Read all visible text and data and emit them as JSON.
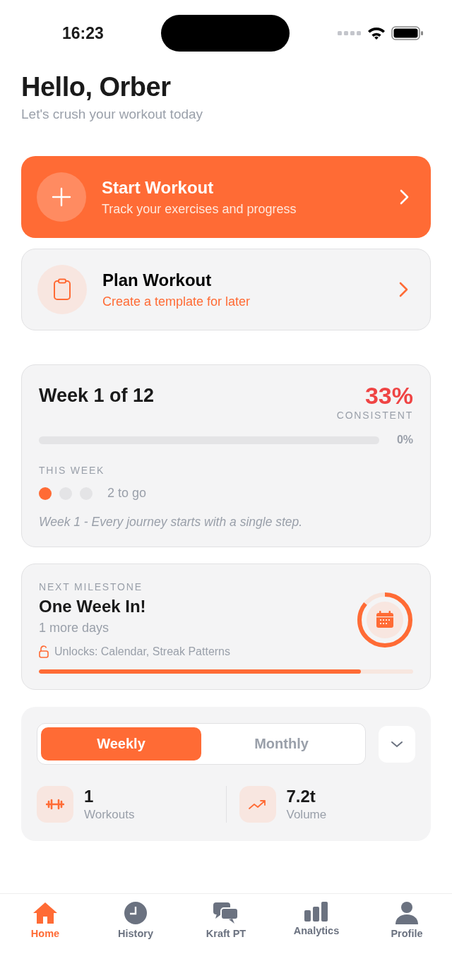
{
  "status_bar": {
    "time": "16:23"
  },
  "greeting": {
    "title": "Hello, Orber",
    "subtitle": "Let's crush your workout today"
  },
  "actions": [
    {
      "kind": "primary",
      "title": "Start Workout",
      "subtitle": "Track your exercises and progress"
    },
    {
      "kind": "secondary",
      "title": "Plan Workout",
      "subtitle": "Create a template for later"
    }
  ],
  "program": {
    "title": "Week 1 of 12",
    "percent": "33%",
    "percent_label": "CONSISTENT",
    "level": 0,
    "progress_text": "0%",
    "week_label": "THIS WEEK",
    "days": [
      {
        "checked": true
      },
      {
        "checked": false
      },
      {
        "checked": false
      }
    ],
    "remaining": "2 to go",
    "quote": "Week 1 - Every journey starts with a single step."
  },
  "milestone": {
    "label": "NEXT MILESTONE",
    "title": "One Week In!",
    "subtitle": "1 more days",
    "unlocks": "Unlocks: Calendar, Streak Patterns",
    "ring": {
      "level": 0.86
    },
    "level": 0.86
  },
  "stats": {
    "tabs": [
      {
        "label": "Weekly",
        "selected": true
      },
      {
        "label": "Monthly",
        "selected": false
      }
    ],
    "items": [
      {
        "kind": "workouts",
        "value": "1",
        "label": "Workouts"
      },
      {
        "kind": "volume",
        "value": "7.2t",
        "label": "Volume"
      }
    ]
  },
  "tab_bar": [
    {
      "kind": "home",
      "label": "Home",
      "selected": true
    },
    {
      "kind": "history",
      "label": "History",
      "selected": false
    },
    {
      "kind": "chat",
      "label": "Kraft PT",
      "selected": false
    },
    {
      "kind": "analytics",
      "label": "Analytics",
      "selected": false
    },
    {
      "kind": "profile",
      "label": "Profile",
      "selected": false
    }
  ]
}
